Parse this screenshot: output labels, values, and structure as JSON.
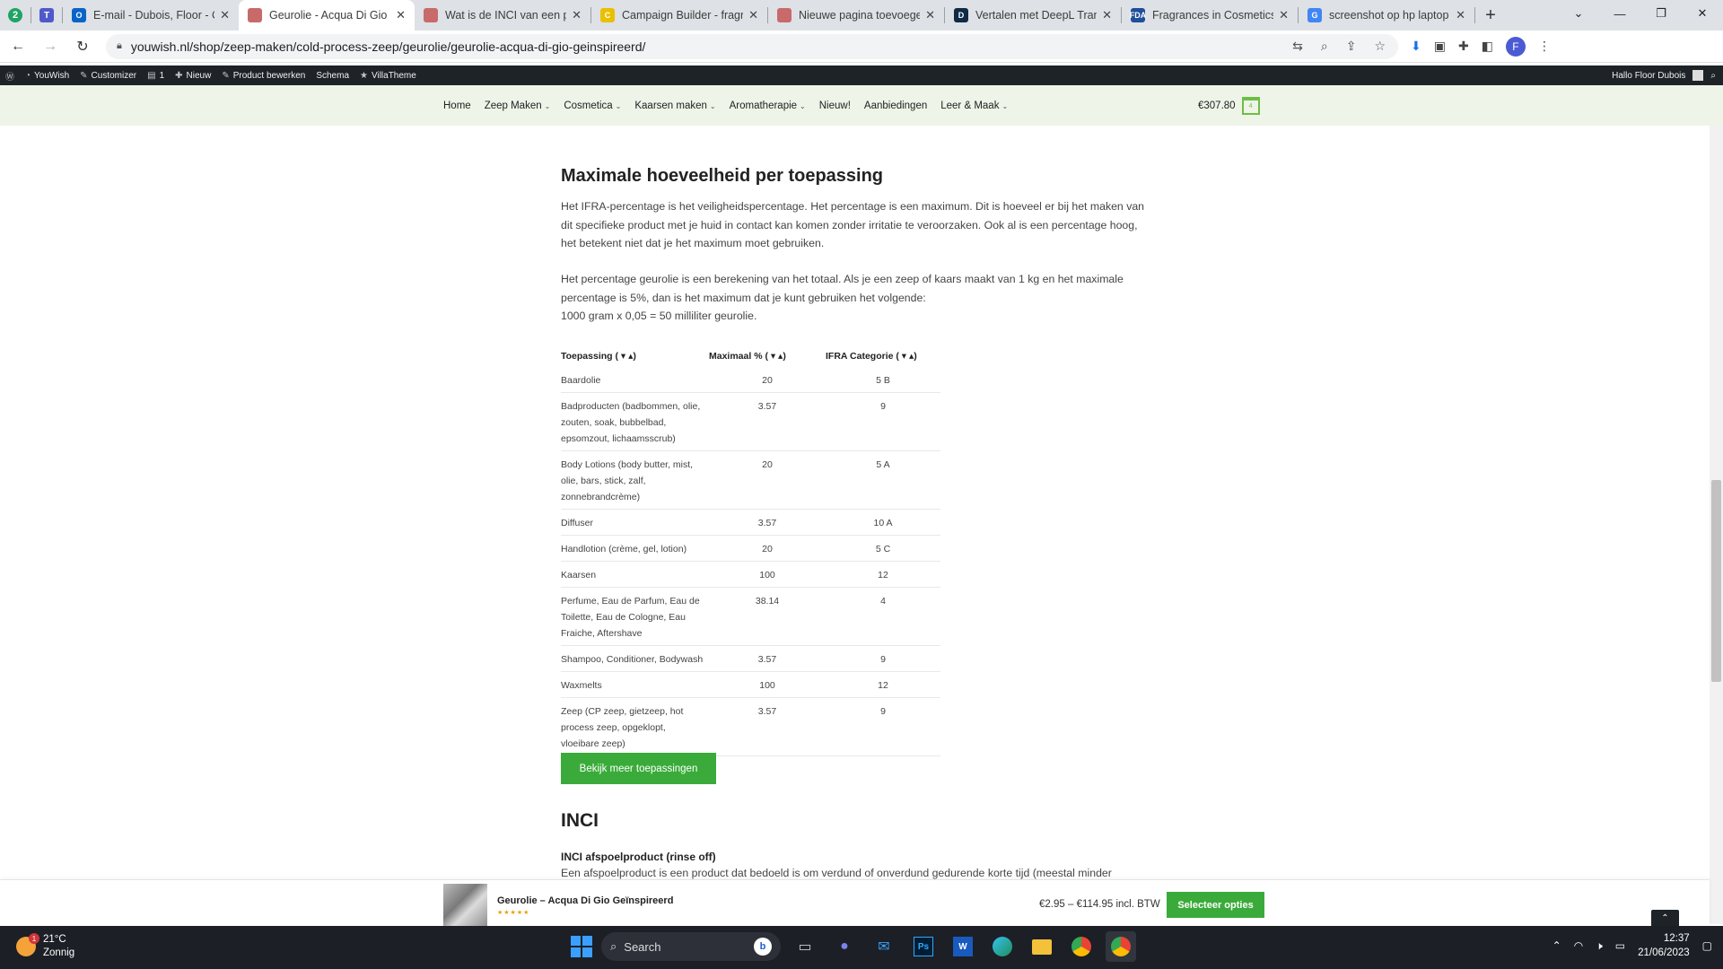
{
  "browser": {
    "pinned_badge": "2",
    "tabs": [
      {
        "title": "E-mail - Dubois, Floor - Outlook",
        "color": "#0a64c8",
        "glyph": "O"
      },
      {
        "title": "Geurolie - Acqua Di Gio Geïnspireerd",
        "color": "#c86a6a",
        "glyph": ""
      },
      {
        "title": "Wat is de INCI van een product",
        "color": "#c86a6a",
        "glyph": ""
      },
      {
        "title": "Campaign Builder - fragrance",
        "color": "#e9c000",
        "glyph": "C"
      },
      {
        "title": "Nieuwe pagina toevoegen",
        "color": "#c86a6a",
        "glyph": ""
      },
      {
        "title": "Vertalen met DeepL Translate",
        "color": "#0f2b46",
        "glyph": "D"
      },
      {
        "title": "Fragrances in Cosmetics",
        "color": "#1f4f9a",
        "glyph": "FDA"
      },
      {
        "title": "screenshot op hp laptop",
        "color": "#4285f4",
        "glyph": "G"
      }
    ],
    "url": "youwish.nl/shop/zeep-maken/cold-process-zeep/geurolie/geurolie-acqua-di-gio-geinspireerd/",
    "profile_initial": "F"
  },
  "adminbar": {
    "site": "YouWish",
    "customizer": "Customizer",
    "comments": "1",
    "new": "Nieuw",
    "edit_product": "Product bewerken",
    "schema": "Schema",
    "villatheme": "VillaTheme",
    "greeting": "Hallo Floor Dubois"
  },
  "nav": {
    "items": [
      {
        "label": "Home",
        "dropdown": false
      },
      {
        "label": "Zeep Maken",
        "dropdown": true
      },
      {
        "label": "Cosmetica",
        "dropdown": true
      },
      {
        "label": "Kaarsen maken",
        "dropdown": true
      },
      {
        "label": "Aromatherapie",
        "dropdown": true
      },
      {
        "label": "Nieuw!",
        "dropdown": false
      },
      {
        "label": "Aanbiedingen",
        "dropdown": false
      },
      {
        "label": "Leer & Maak",
        "dropdown": true
      }
    ],
    "cart_total": "€307.80",
    "cart_count": "4"
  },
  "content": {
    "heading": "Maximale hoeveelheid per toepassing",
    "para1": "Het IFRA-percentage is het veiligheidspercentage. Het percentage is een maximum. Dit is hoeveel er bij het maken van dit specifieke product met je huid in contact kan komen zonder irritatie te veroorzaken. Ook al is een percentage hoog, het betekent niet dat je het maximum moet gebruiken.",
    "para2": "Het percentage geurolie is een berekening van het totaal. Als je een zeep of kaars maakt van 1 kg en het maximale percentage is 5%, dan is het maximum dat je kunt gebruiken het volgende:",
    "para3": "1000 gram x 0,05 = 50 milliliter geurolie.",
    "table": {
      "headers": [
        "Toepassing ( ▾ ▴)",
        "Maximaal % ( ▾ ▴)",
        "IFRA Categorie ( ▾ ▴)"
      ],
      "rows": [
        [
          "Baardolie",
          "20",
          "5 B"
        ],
        [
          "Badproducten (badbommen, olie, zouten, soak, bubbelbad, epsomzout, lichaamsscrub)",
          "3.57",
          "9"
        ],
        [
          "Body Lotions (body butter, mist, olie, bars, stick, zalf, zonnebrandcrème)",
          "20",
          "5 A"
        ],
        [
          "Diffuser",
          "3.57",
          "10 A"
        ],
        [
          "Handlotion (crème, gel, lotion)",
          "20",
          "5 C"
        ],
        [
          "Kaarsen",
          "100",
          "12"
        ],
        [
          "Perfume, Eau de Parfum, Eau de Toilette, Eau de Cologne, Eau Fraiche, Aftershave",
          "38.14",
          "4"
        ],
        [
          "Shampoo, Conditioner, Bodywash",
          "3.57",
          "9"
        ],
        [
          "Waxmelts",
          "100",
          "12"
        ],
        [
          "Zeep (CP zeep, gietzeep, hot process zeep, opgeklopt, vloeibare zeep)",
          "3.57",
          "9"
        ]
      ]
    },
    "more_button": "Bekijk meer toepassingen",
    "inci_heading": "INCI",
    "inci_sub": "INCI afspoelproduct (rinse off)",
    "inci_text": "Een afspoelproduct is een product dat bedoeld is om verdund of onverdund gedurende korte tijd (meestal minder"
  },
  "sticky": {
    "title": "Geurolie – Acqua Di Gio Geïnspireerd",
    "stars": "★★★★★",
    "price": "€2.95 – €114.95 incl. BTW",
    "button": "Selecteer opties"
  },
  "taskbar": {
    "weather_badge": "1",
    "temperature": "21°C",
    "condition": "Zonnig",
    "search": "Search",
    "time": "12:37",
    "date": "21/06/2023"
  }
}
